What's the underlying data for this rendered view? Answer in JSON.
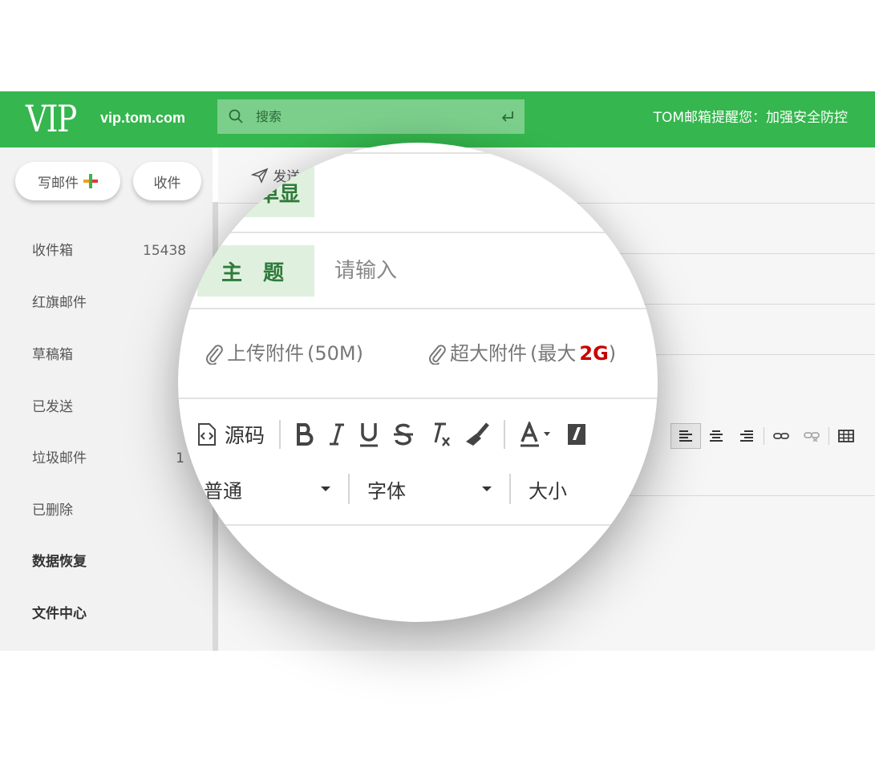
{
  "header": {
    "logo": "VIP",
    "domain": "vip.tom.com",
    "search_placeholder": "搜索",
    "notice": "TOM邮箱提醒您：加强安全防控"
  },
  "sidebar": {
    "compose_label": "写邮件",
    "receive_label": "收件",
    "folders": [
      {
        "label": "收件箱",
        "count": "15438"
      },
      {
        "label": "红旗邮件",
        "count": ""
      },
      {
        "label": "草稿箱",
        "count": ""
      },
      {
        "label": "已发送",
        "count": ""
      },
      {
        "label": "垃圾邮件",
        "count": "1"
      },
      {
        "label": "已删除",
        "count": ""
      },
      {
        "label": "数据恢复",
        "count": ""
      },
      {
        "label": "文件中心",
        "count": ""
      }
    ]
  },
  "compose": {
    "send_label": "发送",
    "summary_label_partial": "单显",
    "subject_label": "主　题",
    "subject_placeholder": "请输入",
    "attach_label": "上传附件",
    "attach_limit": "(50M)",
    "big_attach_label": "超大附件",
    "big_attach_limit_prefix": "(最大",
    "big_attach_limit_value": "2G",
    "big_attach_limit_suffix": ")",
    "source_label": "源码",
    "format_options": {
      "paragraph": "普通",
      "font": "字体",
      "size": "大小"
    }
  },
  "icons": {
    "search": "search-icon",
    "enter": "enter-icon",
    "paperclip": "paperclip-icon",
    "send": "paper-plane-icon",
    "source": "code-file-icon"
  },
  "colors": {
    "brand_green": "#35b64e",
    "label_bg": "#dff1de",
    "label_text": "#2f7a3a",
    "highlight_red": "#c80000"
  }
}
